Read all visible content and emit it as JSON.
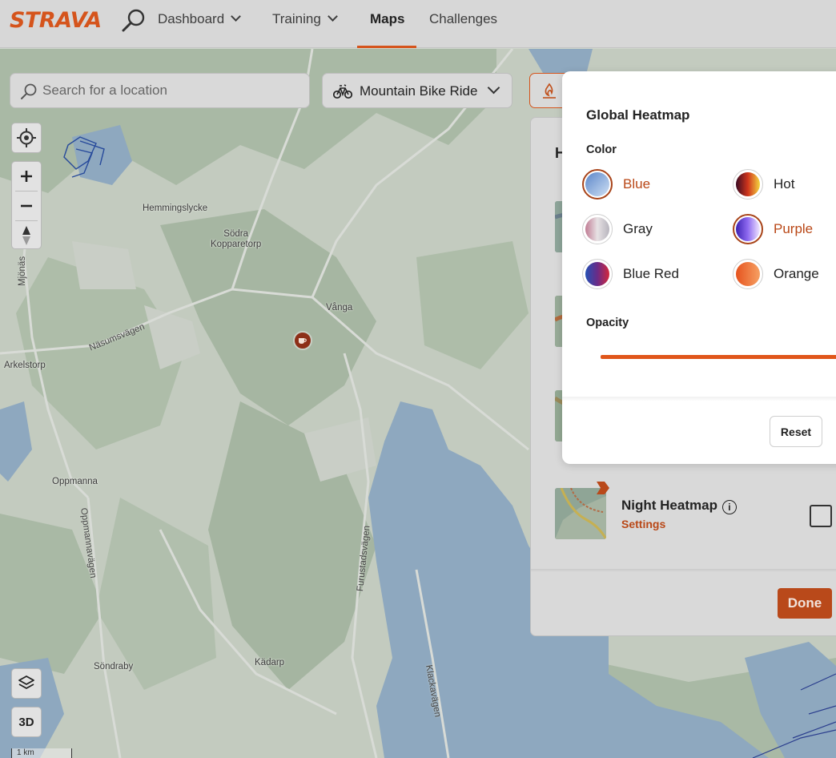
{
  "nav": {
    "logo": "STRAVA",
    "items": [
      {
        "label": "Dashboard"
      },
      {
        "label": "Training"
      },
      {
        "label": "Maps"
      },
      {
        "label": "Challenges"
      }
    ],
    "active_item": "Maps",
    "accent": "#d5541c"
  },
  "map": {
    "search": {
      "placeholder": "Search for a location",
      "value": ""
    },
    "sport_type": "Mountain Bike Ride",
    "controls": {
      "three_d": "3D"
    },
    "scale": "1 km",
    "places": [
      {
        "name": "Hemmingslycke"
      },
      {
        "name": "Södra\nKopparetorp"
      },
      {
        "name": "Vånga"
      },
      {
        "name": "Arkelstorp"
      },
      {
        "name": "Oppmanna"
      },
      {
        "name": "Söndraby"
      },
      {
        "name": "Kädarp"
      }
    ],
    "roads": [
      {
        "name": "Näsumsvägen"
      },
      {
        "name": "Mjönäs"
      },
      {
        "name": "Oppmannavägen"
      },
      {
        "name": "Furustadsvägen"
      },
      {
        "name": "Klackavägen"
      }
    ],
    "poi_icon": "coffee-cup-icon"
  },
  "heatmap_panel": {
    "heading_partial": "H",
    "night_heatmap": {
      "title": "Night Heatmap",
      "settings_label": "Settings",
      "checked": false
    },
    "done_label": "Done"
  },
  "popover": {
    "title": "Global Heatmap",
    "color_label": "Color",
    "colors": [
      {
        "label": "Blue",
        "selected": true,
        "gradient": [
          "#5b86c9",
          "#cfe0f4"
        ]
      },
      {
        "label": "Hot",
        "selected": false,
        "gradient": [
          "#3a0a22",
          "#d0351c",
          "#f4d640"
        ]
      },
      {
        "label": "Gray",
        "selected": false,
        "gradient": [
          "#c07c94",
          "#e7e2e4",
          "#b7b4bd"
        ]
      },
      {
        "label": "Purple",
        "selected": true,
        "gradient": [
          "#3d22b3",
          "#8f6bf0",
          "#f1e7ff"
        ]
      },
      {
        "label": "Blue Red",
        "selected": false,
        "gradient": [
          "#2451b5",
          "#6a2b87",
          "#d4283c"
        ]
      },
      {
        "label": "Orange",
        "selected": false,
        "gradient": [
          "#e6531e",
          "#f6a063"
        ]
      }
    ],
    "opacity_label": "Opacity",
    "reset_label": "Reset"
  }
}
